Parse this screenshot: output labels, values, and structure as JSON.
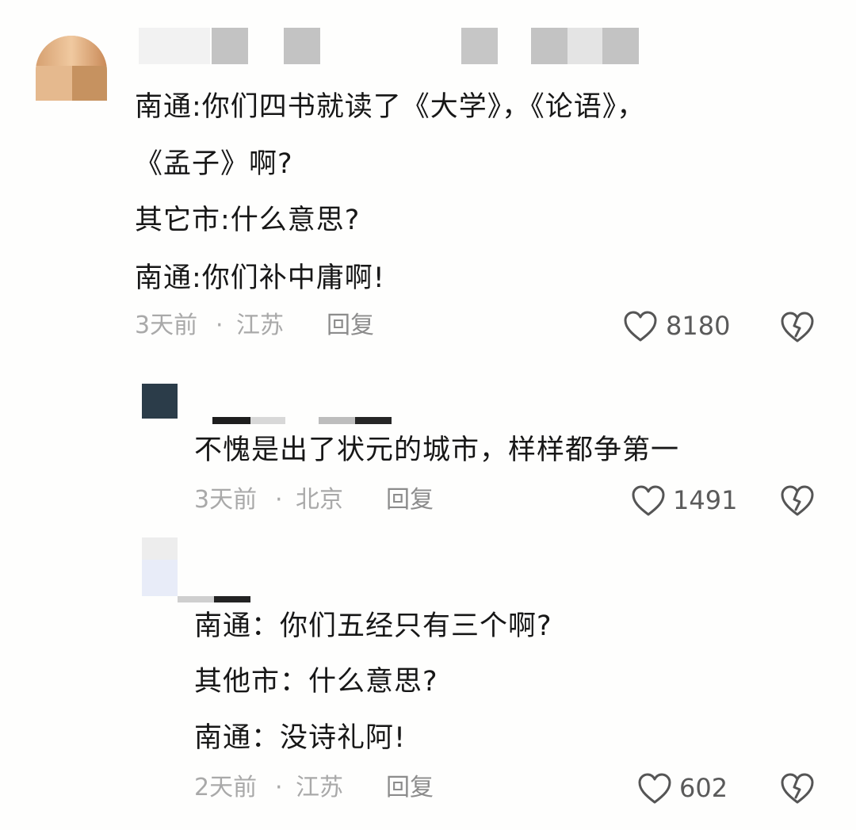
{
  "comments": [
    {
      "lines": [
        "南通:你们四书就读了《大学》，《论语》，",
        "《孟子》啊?",
        "其它市:什么意思?",
        "南通:你们补中庸啊!"
      ],
      "time": "3天前",
      "location": "江苏",
      "reply_label": "回复",
      "likes": "8180"
    },
    {
      "lines": [
        "不愧是出了状元的城市，样样都争第一"
      ],
      "time": "3天前",
      "location": "北京",
      "reply_label": "回复",
      "likes": "1491"
    },
    {
      "lines": [
        "南通：你们五经只有三个啊?",
        "其他市：什么意思?",
        "南通：没诗礼阿!"
      ],
      "time": "2天前",
      "location": "江苏",
      "reply_label": "回复",
      "likes": "602"
    }
  ],
  "separator": "·",
  "icons": {
    "like": "heart-outline-icon",
    "dislike": "broken-heart-icon"
  },
  "colors": {
    "text": "#171717",
    "meta": "#a9a9a9",
    "icon": "#555555"
  }
}
